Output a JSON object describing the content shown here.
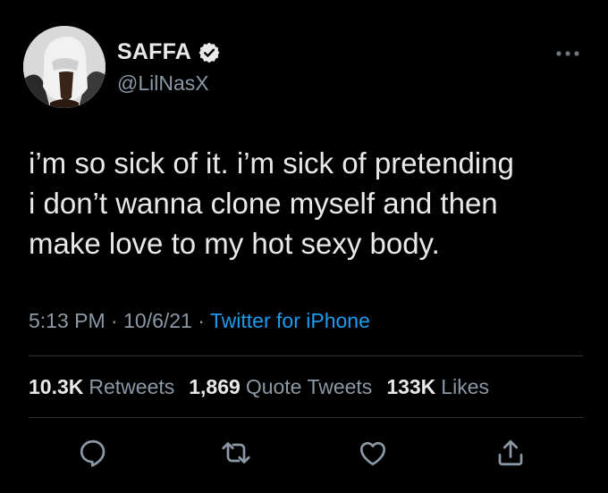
{
  "user": {
    "display_name": "SAFFA",
    "handle": "@LilNasX",
    "avatar_icon": "avatar-photo",
    "verified_icon": "verified-badge-icon"
  },
  "tweet": {
    "text": "i’m so sick of it. i’m sick of pretending\ni don’t wanna clone myself and then\nmake love to my hot sexy body.",
    "time": "5:13 PM",
    "date": "10/6/21",
    "separator": "·",
    "source": "Twitter for iPhone"
  },
  "stats": {
    "retweets_count": "10.3K",
    "retweets_label": "Retweets",
    "quotes_count": "1,869",
    "quotes_label": "Quote Tweets",
    "likes_count": "133K",
    "likes_label": "Likes"
  },
  "actions": [
    "reply-icon",
    "retweet-icon",
    "like-icon",
    "share-icon"
  ],
  "colors": {
    "background": "#000000",
    "text": "#e7e9ea",
    "secondary": "#8b98a5",
    "link": "#1d9bf0",
    "divider": "#2f3336"
  }
}
